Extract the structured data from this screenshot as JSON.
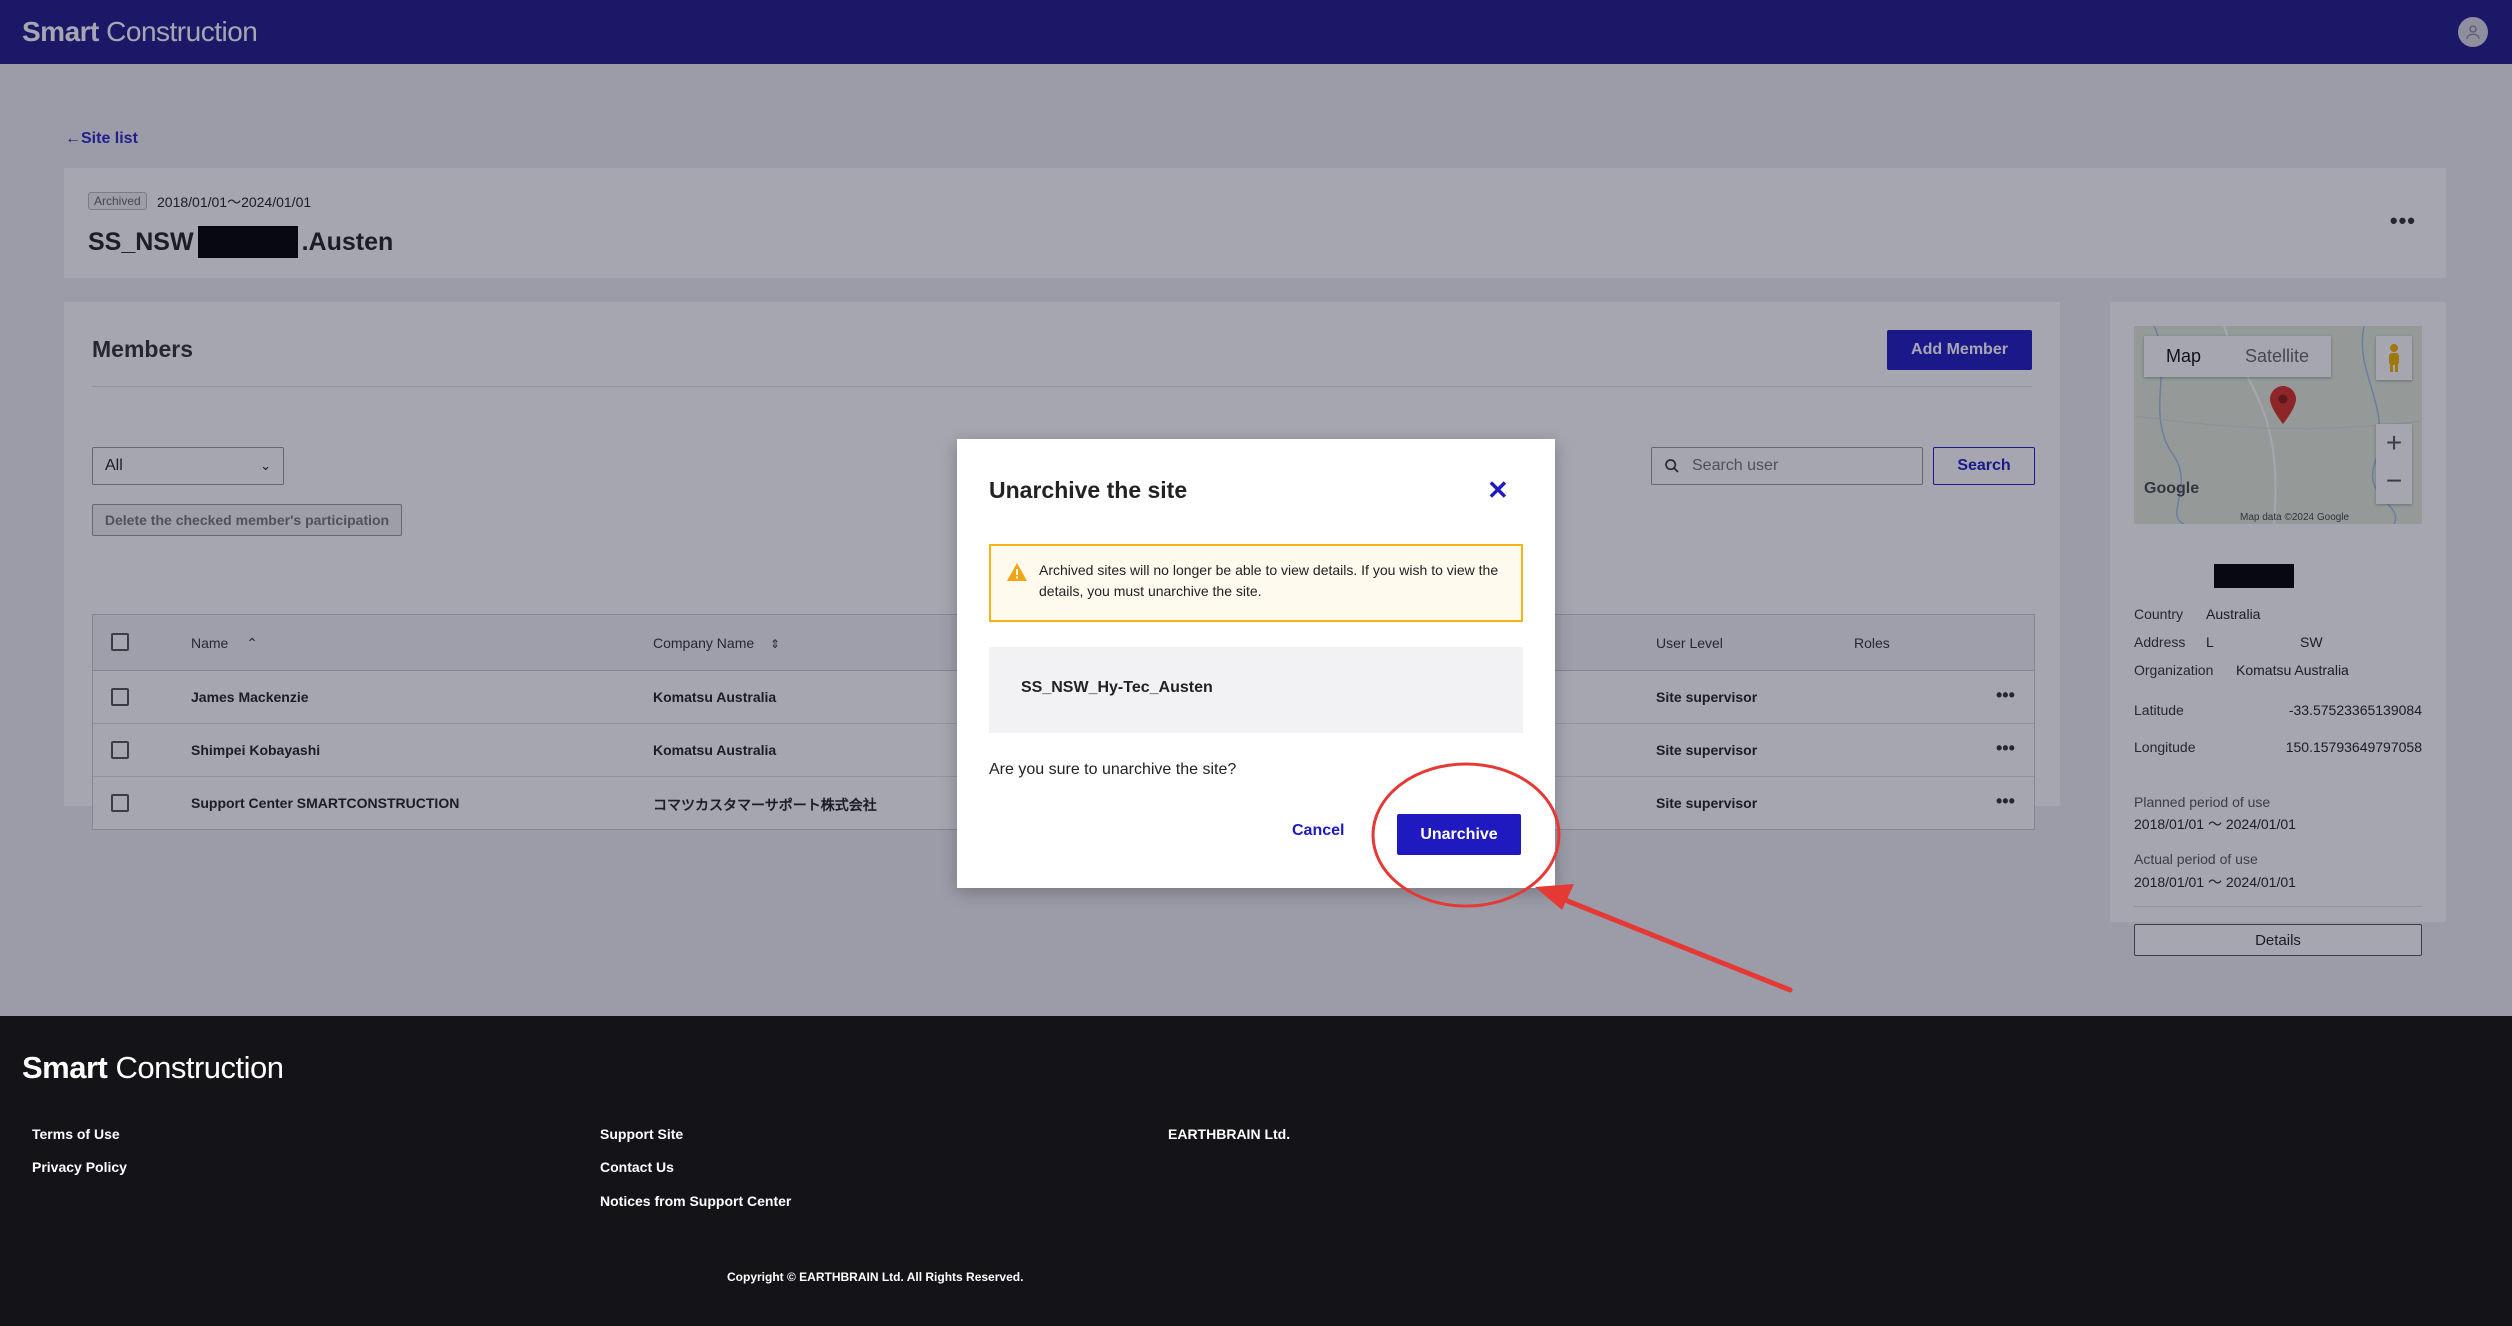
{
  "header": {
    "brand_bold": "Smart",
    "brand_rest": " Construction"
  },
  "nav": {
    "back_label": "Site list"
  },
  "site": {
    "status_badge": "Archived",
    "period": "2018/01/01～2024/01/01",
    "name_prefix": "SS_NSW",
    "name_suffix": ".Austen"
  },
  "members": {
    "title": "Members",
    "add_label": "Add Member",
    "filter_value": "All",
    "delete_label": "Delete the checked member's participation",
    "search_placeholder": "Search user",
    "search_label": "Search",
    "columns": {
      "name": "Name",
      "company": "Company Name",
      "level": "User Level",
      "roles": "Roles"
    },
    "rows": [
      {
        "name": "James Mackenzie",
        "company": "Komatsu Australia",
        "level": "Site supervisor"
      },
      {
        "name": "Shimpei Kobayashi",
        "company": "Komatsu Australia",
        "level": "Site supervisor"
      },
      {
        "name": "Support Center SMARTCONSTRUCTION",
        "company": "コマツカスタマーサポート株式会社",
        "level": "Site supervisor"
      }
    ]
  },
  "map": {
    "tab_map": "Map",
    "tab_satellite": "Satellite",
    "google_label": "Google",
    "attribution": "Map data ©2024 Google"
  },
  "info": {
    "country_label": "Country",
    "country_value": "Australia",
    "address_label": "Address",
    "address_value_start": "L",
    "address_value_end": "SW",
    "org_label": "Organization",
    "org_value": "Komatsu Australia",
    "lat_label": "Latitude",
    "lat_value": "-33.57523365139084",
    "lng_label": "Longitude",
    "lng_value": "150.15793649797058",
    "planned_label": "Planned period of use",
    "planned_value": "2018/01/01 ～ 2024/01/01",
    "actual_label": "Actual period of use",
    "actual_value": "2018/01/01 ～ 2024/01/01",
    "details_label": "Details"
  },
  "footer": {
    "terms": "Terms of Use",
    "privacy": "Privacy Policy",
    "support_site": "Support Site",
    "contact": "Contact Us",
    "notices": "Notices from Support Center",
    "company": "EARTHBRAIN Ltd.",
    "copyright": "Copyright © EARTHBRAIN Ltd. All Rights Reserved."
  },
  "modal": {
    "title": "Unarchive the site",
    "warning": "Archived sites will no longer be able to view details. If you wish to view the details, you must unarchive the site.",
    "site_name": "SS_NSW_Hy-Tec_Austen",
    "confirm_text": "Are you sure to unarchive the site?",
    "cancel_label": "Cancel",
    "unarchive_label": "Unarchive"
  },
  "colors": {
    "brand": "#1f1a8a",
    "primary": "#1f1ac0",
    "warning": "#f2b31b",
    "annotation": "#e53935"
  }
}
